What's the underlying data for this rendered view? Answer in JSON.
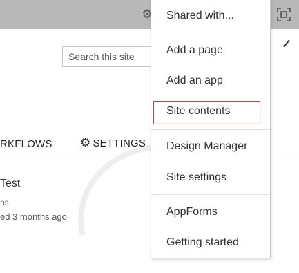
{
  "header": {
    "settings_icon": "gear-icon",
    "focus_icon": "focus-on-content-icon"
  },
  "search": {
    "placeholder": "Search this site"
  },
  "nav": {
    "workflows": "RKFLOWS",
    "settings": "SETTINGS",
    "settings_icon": "gear-icon"
  },
  "list": {
    "title": "Test",
    "line1": "ns",
    "line2": "ed 3 months ago"
  },
  "menu": {
    "shared_with": "Shared with...",
    "add_page": "Add a page",
    "add_app": "Add an app",
    "site_contents": "Site contents",
    "design_manager": "Design Manager",
    "site_settings": "Site settings",
    "appforms": "AppForms",
    "getting_started": "Getting started"
  },
  "colors": {
    "topbar": "#b8b8b8",
    "highlight": "#e0393e"
  }
}
